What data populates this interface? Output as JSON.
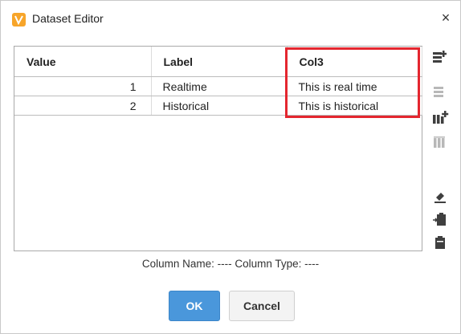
{
  "window": {
    "title": "Dataset Editor",
    "close_symbol": "×"
  },
  "table": {
    "columns": [
      "Value",
      "Label",
      "Col3"
    ],
    "rows": [
      {
        "value": "1",
        "label": "Realtime",
        "col3": "This is real time"
      },
      {
        "value": "2",
        "label": "Historical",
        "col3": "This is historical"
      }
    ]
  },
  "toolbar": {
    "icons": [
      "add-row-icon",
      "remove-row-icon",
      "add-column-icon",
      "remove-column-icon",
      "edit-column-icon",
      "paste-icon",
      "clipboard-icon"
    ]
  },
  "footer": {
    "column_info": "Column Name: ----   Column Type: ----"
  },
  "buttons": {
    "ok": "OK",
    "cancel": "Cancel"
  },
  "colors": {
    "accent": "#4a97db",
    "highlight": "#e4262f",
    "app_icon": "#f7a52a"
  }
}
